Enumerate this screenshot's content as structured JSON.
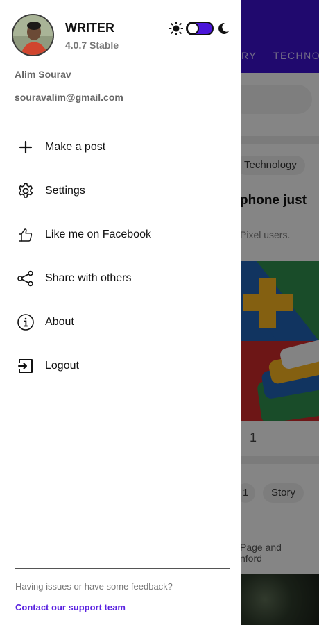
{
  "background": {
    "tabs": [
      "RY",
      "TECHNO"
    ],
    "chips": [
      "Technology",
      "1",
      "Story"
    ],
    "headline": "phone just",
    "subtext": "Pixel users.",
    "number": "1",
    "footer_lines": [
      "Page and",
      "nford"
    ],
    "colors": {
      "appbar": "#3b12c9"
    }
  },
  "drawer": {
    "app_name": "WRITER",
    "version": "4.0.7 Stable",
    "user_name": "Alim Sourav",
    "user_email": "souravalim@gmail.com",
    "theme_toggle": {
      "state": "on",
      "left_icon": "sun-icon",
      "right_icon": "moon-icon",
      "accent": "#4a15d8"
    },
    "menu": [
      {
        "label": "Make a post",
        "icon": "plus-icon"
      },
      {
        "label": "Settings",
        "icon": "gear-icon"
      },
      {
        "label": "Like me on Facebook",
        "icon": "thumbs-up-icon"
      },
      {
        "label": "Share with others",
        "icon": "share-icon"
      },
      {
        "label": "About",
        "icon": "info-icon"
      },
      {
        "label": "Logout",
        "icon": "logout-icon"
      }
    ],
    "feedback_text": "Having issues or have some feedback?",
    "support_link": "Contact our support team",
    "colors": {
      "link": "#5a22e0"
    }
  }
}
